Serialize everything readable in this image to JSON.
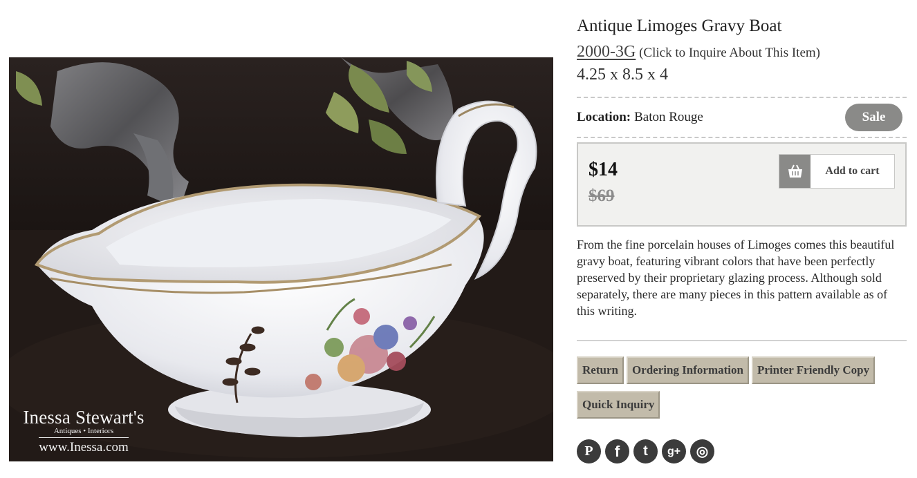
{
  "product": {
    "title": "Antique Limoges Gravy Boat",
    "sku": "2000-3G",
    "inquire_text": "(Click to Inquire About This Item)",
    "dimensions": "4.25 x 8.5 x 4",
    "location_label": "Location:",
    "location_value": "Baton Rouge",
    "badge": "Sale",
    "price_current": "$14",
    "price_original": "$69",
    "add_to_cart_label": "Add to cart",
    "description": "From the fine porcelain houses of Limoges comes this beautiful gravy boat, featuring vibrant colors that have been perfectly preserved by their proprietary glazing process. Although sold separately, there are many pieces in this pattern available as of this writing."
  },
  "watermark": {
    "name": "Inessa Stewart's",
    "tagline": "Antiques • Interiors",
    "url": "www.Inessa.com"
  },
  "actions": [
    {
      "label": "Return"
    },
    {
      "label": "Ordering Information"
    },
    {
      "label": "Printer Friendly Copy"
    },
    {
      "label": "Quick Inquiry"
    }
  ],
  "social": [
    {
      "icon": "pinterest-icon",
      "glyph": "P"
    },
    {
      "icon": "facebook-icon",
      "glyph": "f"
    },
    {
      "icon": "twitter-icon",
      "glyph": "t"
    },
    {
      "icon": "google-plus-icon",
      "glyph": "g+"
    },
    {
      "icon": "instagram-icon",
      "glyph": "◎"
    }
  ],
  "colors": {
    "badge": "#8a8a88",
    "button_bg": "#c2bbaa",
    "price_box_bg": "#f1f1ef"
  }
}
